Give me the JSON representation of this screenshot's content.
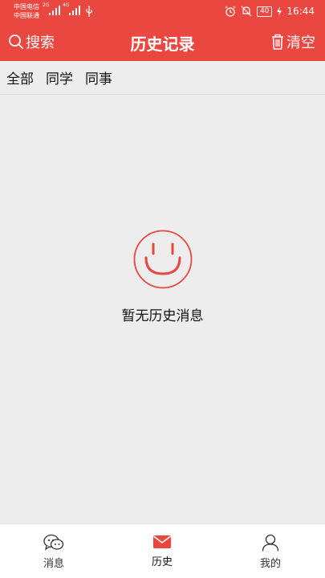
{
  "status_bar": {
    "carrier1": "中国电信",
    "carrier2": "中国联通",
    "net1": "2G",
    "net2": "4G",
    "battery": "40",
    "time": "16:44"
  },
  "header": {
    "search_label": "搜索",
    "title": "历史记录",
    "clear_label": "清空"
  },
  "filter_tabs": [
    {
      "label": "全部"
    },
    {
      "label": "同学"
    },
    {
      "label": "同事"
    }
  ],
  "empty_state": {
    "message": "暂无历史消息"
  },
  "bottom_nav": [
    {
      "label": "消息",
      "icon": "chat-icon"
    },
    {
      "label": "历史",
      "icon": "mail-icon",
      "active": true
    },
    {
      "label": "我的",
      "icon": "person-icon"
    }
  ],
  "colors": {
    "accent": "#e9473f",
    "background": "#ededed"
  }
}
